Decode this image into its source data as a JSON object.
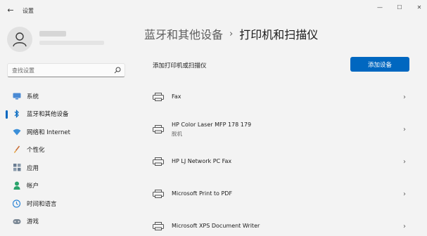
{
  "window": {
    "title": "设置",
    "back_glyph": "←",
    "controls": {
      "minimize": "—",
      "maximize": "☐",
      "close": "✕"
    }
  },
  "search": {
    "placeholder": "查找设置"
  },
  "nav": {
    "items": [
      {
        "label": "系统",
        "icon": "monitor-icon",
        "active": false
      },
      {
        "label": "蓝牙和其他设备",
        "icon": "bluetooth-icon",
        "active": true
      },
      {
        "label": "网络和 Internet",
        "icon": "wifi-icon",
        "active": false
      },
      {
        "label": "个性化",
        "icon": "brush-icon",
        "active": false
      },
      {
        "label": "应用",
        "icon": "apps-icon",
        "active": false
      },
      {
        "label": "帐户",
        "icon": "person-icon",
        "active": false
      },
      {
        "label": "时间和语言",
        "icon": "globe-clock-icon",
        "active": false
      },
      {
        "label": "游戏",
        "icon": "gamepad-icon",
        "active": false
      }
    ]
  },
  "main": {
    "breadcrumb": {
      "parent": "蓝牙和其他设备",
      "separator": "›",
      "current": "打印机和扫描仪"
    },
    "add_row": {
      "label": "添加打印机或扫描仪",
      "button": "添加设备"
    },
    "devices": [
      {
        "name": "Fax",
        "status": ""
      },
      {
        "name": "HP Color Laser MFP 178 179",
        "status": "脱机"
      },
      {
        "name": "HP LJ Network PC Fax",
        "status": ""
      },
      {
        "name": "Microsoft Print to PDF",
        "status": ""
      },
      {
        "name": "Microsoft XPS Document Writer",
        "status": ""
      }
    ],
    "chevron": "›"
  },
  "colors": {
    "accent": "#0067c0",
    "background": "#f3f3f3"
  }
}
